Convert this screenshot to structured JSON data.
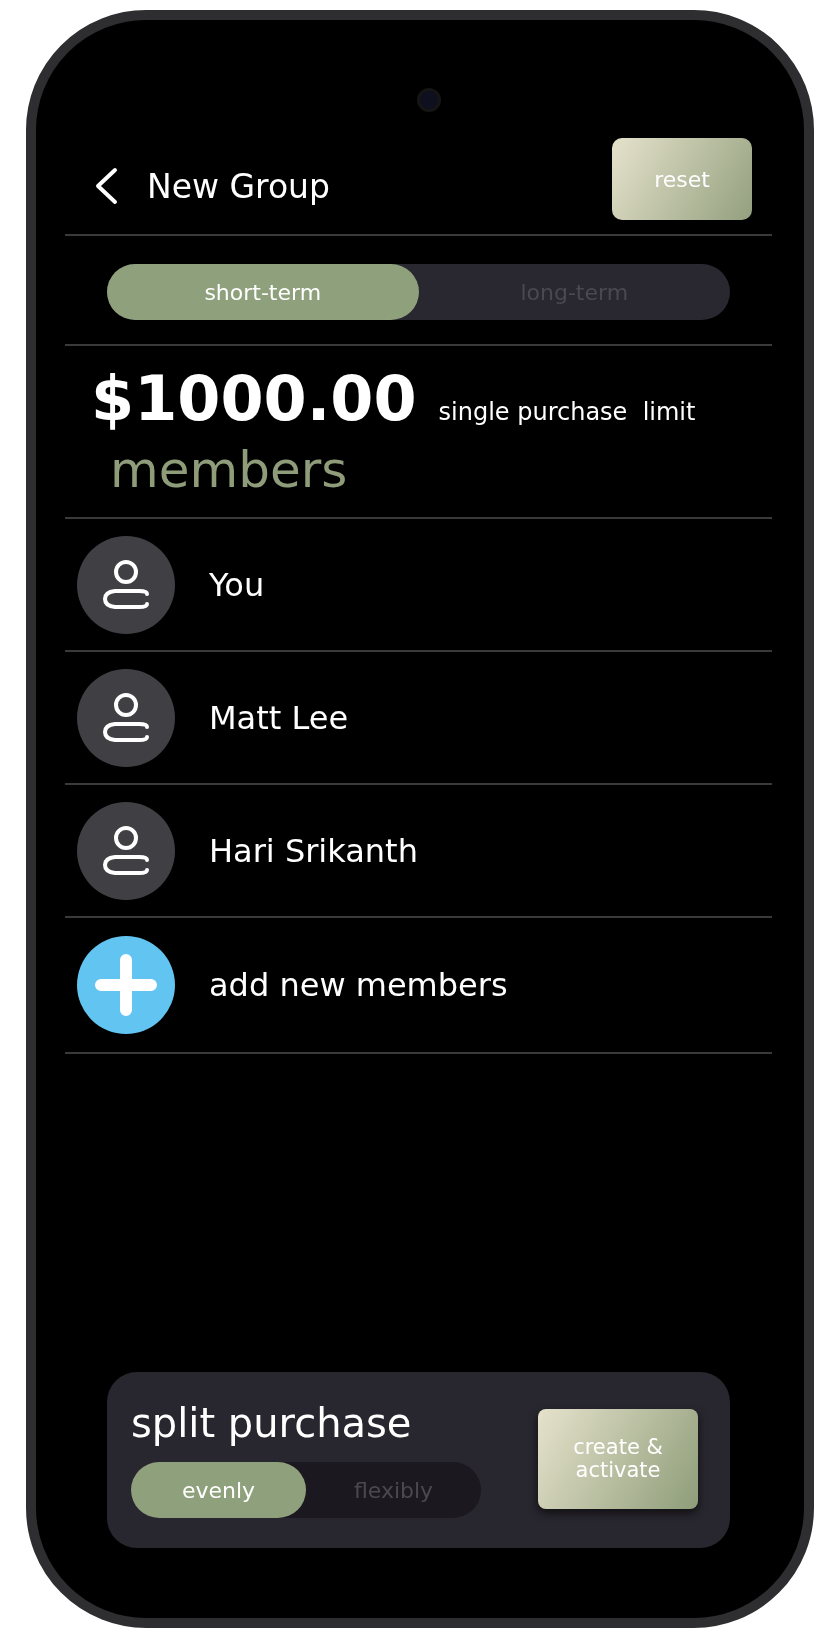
{
  "header": {
    "title": "New Group",
    "reset_button": "reset"
  },
  "term_tabs": [
    {
      "label": "short-term",
      "selected": true
    },
    {
      "label": "long-term",
      "selected": false
    }
  ],
  "limit": {
    "amount": "$1000.00",
    "label": "single purchase  limit"
  },
  "members_heading": "members",
  "members": [
    {
      "name": "You",
      "kind": "member"
    },
    {
      "name": "Matt Lee",
      "kind": "member"
    },
    {
      "name": "Hari Srikanth",
      "kind": "member"
    },
    {
      "name": "add new members",
      "kind": "add"
    }
  ],
  "split": {
    "title": "split purchase",
    "options": [
      {
        "label": "evenly",
        "selected": true
      },
      {
        "label": "flexibly",
        "selected": false
      }
    ],
    "action_button": "create & activate"
  }
}
